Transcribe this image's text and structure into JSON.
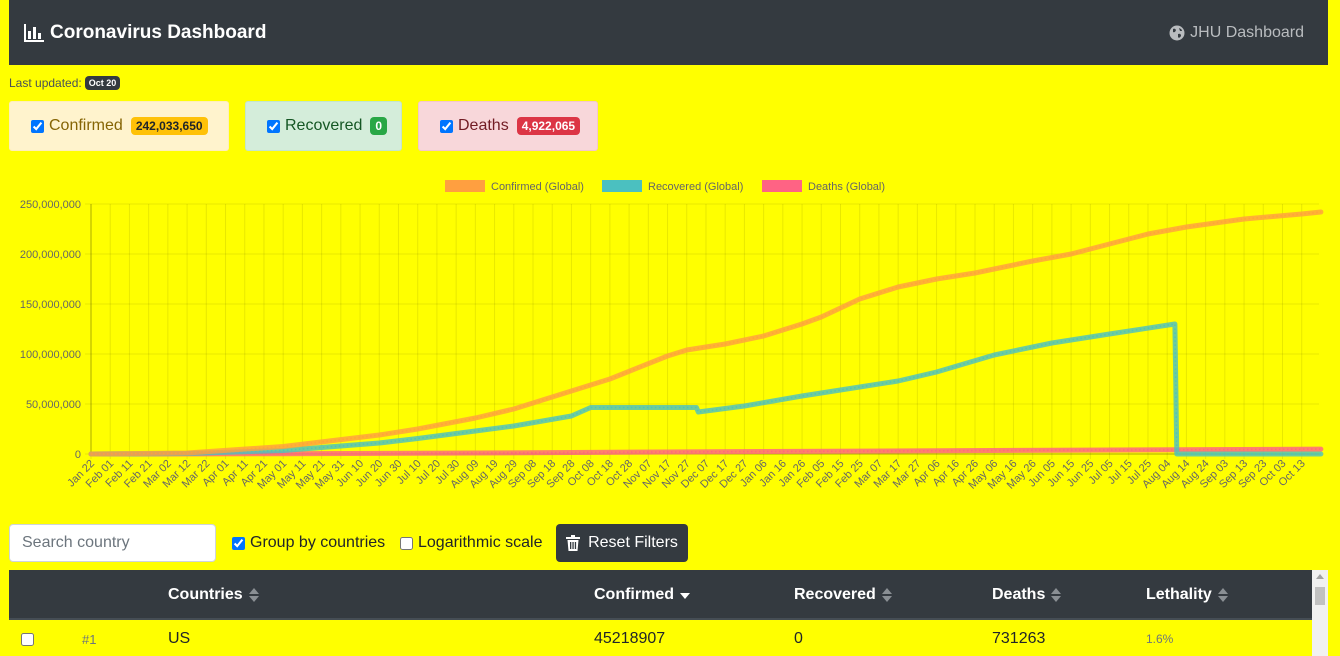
{
  "navbar": {
    "brand": "Coronavirus Dashboard",
    "link": "JHU Dashboard"
  },
  "last_updated": {
    "label": "Last updated:",
    "date": "Oct 20"
  },
  "stats": {
    "confirmed": {
      "label": "Confirmed",
      "value": "242,033,650",
      "checked": true,
      "color": "#ffc107"
    },
    "recovered": {
      "label": "Recovered",
      "value": "0",
      "checked": true,
      "color": "#28a745"
    },
    "deaths": {
      "label": "Deaths",
      "value": "4,922,065",
      "checked": true,
      "color": "#dc3545"
    }
  },
  "chart_data": {
    "type": "line",
    "ylim": [
      0,
      250000000
    ],
    "y_ticks": [
      0,
      50000000,
      100000000,
      150000000,
      200000000,
      250000000
    ],
    "y_tick_labels": [
      "0",
      "50,000,000",
      "100,000,000",
      "150,000,000",
      "200,000,000",
      "250,000,000"
    ],
    "x_tick_labels": [
      "Jan 22",
      "Feb 01",
      "Feb 11",
      "Feb 21",
      "Mar 02",
      "Mar 12",
      "Mar 22",
      "Apr 01",
      "Apr 11",
      "Apr 21",
      "May 01",
      "May 11",
      "May 21",
      "May 31",
      "Jun 10",
      "Jun 20",
      "Jun 30",
      "Jul 10",
      "Jul 20",
      "Jul 30",
      "Aug 09",
      "Aug 19",
      "Aug 29",
      "Sep 08",
      "Sep 18",
      "Sep 28",
      "Oct 08",
      "Oct 18",
      "Oct 28",
      "Nov 07",
      "Nov 17",
      "Nov 27",
      "Dec 07",
      "Dec 17",
      "Dec 27",
      "Jan 06",
      "Jan 16",
      "Jan 26",
      "Feb 05",
      "Feb 15",
      "Feb 25",
      "Mar 07",
      "Mar 17",
      "Mar 27",
      "Apr 06",
      "Apr 16",
      "Apr 26",
      "May 06",
      "May 16",
      "May 26",
      "Jun 05",
      "Jun 15",
      "Jun 25",
      "Jul 05",
      "Jul 15",
      "Jul 25",
      "Aug 04",
      "Aug 14",
      "Aug 24",
      "Sep 03",
      "Sep 13",
      "Sep 23",
      "Oct 03",
      "Oct 13"
    ],
    "grid": true,
    "legend_position": "top",
    "series": [
      {
        "name": "Confirmed (Global)",
        "color": "#ff9f40",
        "x": [
          0,
          5,
          10,
          15,
          17,
          20,
          22,
          25,
          27,
          30,
          31,
          33,
          35,
          37,
          38,
          40,
          42,
          44,
          46,
          47,
          49,
          51,
          53,
          55,
          57,
          60,
          63,
          64
        ],
        "values": [
          0,
          1000000,
          7500000,
          19000000,
          25000000,
          36000000,
          45000000,
          63000000,
          75000000,
          98000000,
          104000000,
          110000000,
          118000000,
          130000000,
          137000000,
          155000000,
          167000000,
          175000000,
          181000000,
          185000000,
          193000000,
          200000000,
          210000000,
          220000000,
          227000000,
          235000000,
          240000000,
          242000000
        ]
      },
      {
        "name": "Recovered (Global)",
        "color": "#4bc0c0",
        "x": [
          0,
          5,
          10,
          15,
          17,
          20,
          22,
          25,
          26,
          31.5,
          31.6,
          34,
          37,
          40,
          42,
          44,
          47,
          50,
          53,
          56.4,
          56.5,
          64
        ],
        "values": [
          0,
          500000,
          3500000,
          11000000,
          15500000,
          23000000,
          28000000,
          38000000,
          46500000,
          46500000,
          42000000,
          48000000,
          58000000,
          67000000,
          73000000,
          82000000,
          99000000,
          111000000,
          120000000,
          130000000,
          0,
          0
        ]
      },
      {
        "name": "Deaths (Global)",
        "color": "#ff6384",
        "x": [
          0,
          10,
          20,
          30,
          40,
          50,
          56.5,
          64
        ],
        "values": [
          0,
          300000,
          1000000,
          2000000,
          2900000,
          3800000,
          4250000,
          4922065
        ]
      }
    ]
  },
  "filters": {
    "search_placeholder": "Search country",
    "group_label": "Group by countries",
    "group_checked": true,
    "log_label": "Logarithmic scale",
    "log_checked": false,
    "reset_label": "Reset Filters"
  },
  "table": {
    "headers": {
      "countries": "Countries",
      "confirmed": "Confirmed",
      "recovered": "Recovered",
      "deaths": "Deaths",
      "lethality": "Lethality"
    },
    "rows": [
      {
        "rank": "#1",
        "country": "US",
        "confirmed": "45218907",
        "recovered": "0",
        "deaths": "731263",
        "lethality": "1.6%"
      }
    ]
  }
}
